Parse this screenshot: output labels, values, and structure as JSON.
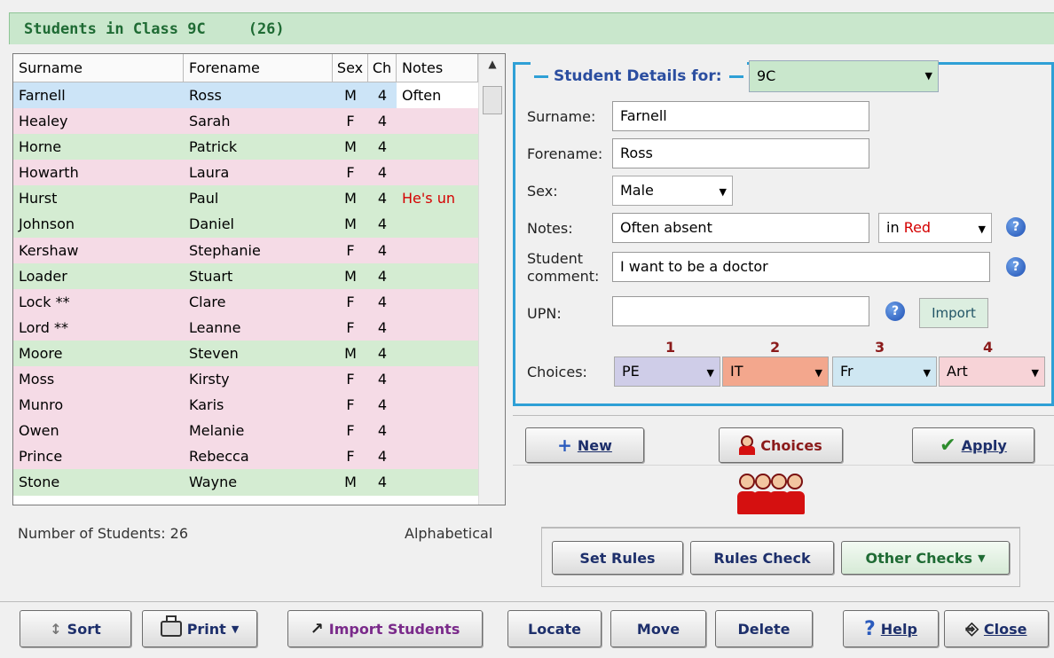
{
  "header": {
    "title": "Students in Class 9C",
    "count": "(26)"
  },
  "table": {
    "columns": [
      "Surname",
      "Forename",
      "Sex",
      "Ch",
      "Notes"
    ],
    "rows": [
      {
        "surname": "Farnell",
        "forename": "Ross",
        "sex": "M",
        "ch": "4",
        "notes": "Often",
        "style": "selected"
      },
      {
        "surname": "Healey",
        "forename": "Sarah",
        "sex": "F",
        "ch": "4",
        "notes": "",
        "style": "pink"
      },
      {
        "surname": "Horne",
        "forename": "Patrick",
        "sex": "M",
        "ch": "4",
        "notes": "",
        "style": "green"
      },
      {
        "surname": "Howarth",
        "forename": "Laura",
        "sex": "F",
        "ch": "4",
        "notes": "",
        "style": "pink"
      },
      {
        "surname": "Hurst",
        "forename": "Paul",
        "sex": "M",
        "ch": "4",
        "notes": "He's un",
        "style": "green"
      },
      {
        "surname": "Johnson",
        "forename": "Daniel",
        "sex": "M",
        "ch": "4",
        "notes": "",
        "style": "green"
      },
      {
        "surname": "Kershaw",
        "forename": "Stephanie",
        "sex": "F",
        "ch": "4",
        "notes": "",
        "style": "pink"
      },
      {
        "surname": "Loader",
        "forename": "Stuart",
        "sex": "M",
        "ch": "4",
        "notes": "",
        "style": "green"
      },
      {
        "surname": "Lock **",
        "forename": "Clare",
        "sex": "F",
        "ch": "4",
        "notes": "",
        "style": "pink"
      },
      {
        "surname": "Lord **",
        "forename": "Leanne",
        "sex": "F",
        "ch": "4",
        "notes": "",
        "style": "pink"
      },
      {
        "surname": "Moore",
        "forename": "Steven",
        "sex": "M",
        "ch": "4",
        "notes": "",
        "style": "green"
      },
      {
        "surname": "Moss",
        "forename": "Kirsty",
        "sex": "F",
        "ch": "4",
        "notes": "",
        "style": "pink"
      },
      {
        "surname": "Munro",
        "forename": "Karis",
        "sex": "F",
        "ch": "4",
        "notes": "",
        "style": "pink"
      },
      {
        "surname": "Owen",
        "forename": "Melanie",
        "sex": "F",
        "ch": "4",
        "notes": "",
        "style": "pink"
      },
      {
        "surname": "Prince",
        "forename": "Rebecca",
        "sex": "F",
        "ch": "4",
        "notes": "",
        "style": "pink"
      },
      {
        "surname": "Stone",
        "forename": "Wayne",
        "sex": "M",
        "ch": "4",
        "notes": "",
        "style": "green"
      }
    ]
  },
  "status": {
    "count_label": "Number of Students: 26",
    "sort_label": "Alphabetical"
  },
  "details": {
    "legend": "Student Details for:",
    "class_value": "9C",
    "surname_label": "Surname:",
    "surname": "Farnell",
    "forename_label": "Forename:",
    "forename": "Ross",
    "sex_label": "Sex:",
    "sex": "Male",
    "notes_label": "Notes:",
    "notes": "Often absent",
    "notes_color_prefix": "in",
    "notes_color": "Red",
    "comment_label_1": "Student",
    "comment_label_2": "comment:",
    "comment": "I want to be a doctor",
    "upn_label": "UPN:",
    "upn": "",
    "import_label": "Import",
    "choices_label": "Choices:",
    "choices": [
      {
        "num": "1",
        "value": "PE",
        "color": "#cfcde8"
      },
      {
        "num": "2",
        "value": "IT",
        "color": "#f3a78d"
      },
      {
        "num": "3",
        "value": "Fr",
        "color": "#cfe7f2"
      },
      {
        "num": "4",
        "value": "Art",
        "color": "#f7d3d7"
      }
    ]
  },
  "actions": {
    "new": "New",
    "choices": "Choices",
    "apply": "Apply"
  },
  "rules": {
    "set_rules": "Set Rules",
    "rules_check": "Rules Check",
    "other_checks": "Other Checks"
  },
  "toolbar": {
    "sort": "Sort",
    "print": "Print",
    "import_students": "Import Students",
    "locate": "Locate",
    "move": "Move",
    "delete": "Delete",
    "help": "Help",
    "close": "Close"
  },
  "colors": {
    "pink_row": "#f5dbe6",
    "green_row": "#d4ecd2",
    "accent": "#2fa0d6",
    "title_green": "#1f6b34"
  }
}
